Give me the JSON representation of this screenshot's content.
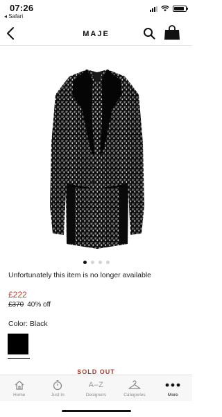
{
  "status_bar": {
    "time": "07:26",
    "back_app": "◂ Safari",
    "battery_level": 0.9
  },
  "nav": {
    "title": "MAJE"
  },
  "product": {
    "unavailable_text": "Unfortunately this item is no longer available",
    "price_now": "£222",
    "price_was": "£370",
    "discount": "40% off",
    "color_label": "Color: Black",
    "swatch_color": "#000000",
    "sold_out_label": "SOLD OUT"
  },
  "gallery": {
    "total_images": 4,
    "active_index": 0
  },
  "tab_bar": {
    "tabs": [
      {
        "label": "Home",
        "icon": "home-icon"
      },
      {
        "label": "Just In",
        "icon": "stopwatch-icon"
      },
      {
        "label": "Designers",
        "icon": "a-z-icon",
        "glyph": "A–Z"
      },
      {
        "label": "Categories",
        "icon": "hanger-icon"
      },
      {
        "label": "More",
        "icon": "more-dots-icon"
      }
    ]
  },
  "colors": {
    "price_accent": "#c0392b",
    "sold_out": "#b03a2e"
  }
}
